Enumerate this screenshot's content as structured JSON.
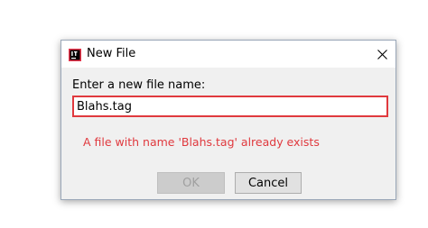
{
  "dialog": {
    "title": "New File",
    "app_icon": "jetbrains-icon",
    "close_icon": "close-icon",
    "prompt": "Enter a new file name:",
    "input_value": "Blahs.tag",
    "error_message": "A file with name 'Blahs.tag' already exists",
    "ok_label": "OK",
    "cancel_label": "Cancel"
  },
  "colors": {
    "error": "#e0393e",
    "dialog_bg": "#f0f0f0",
    "titlebar_bg": "#ffffff"
  }
}
